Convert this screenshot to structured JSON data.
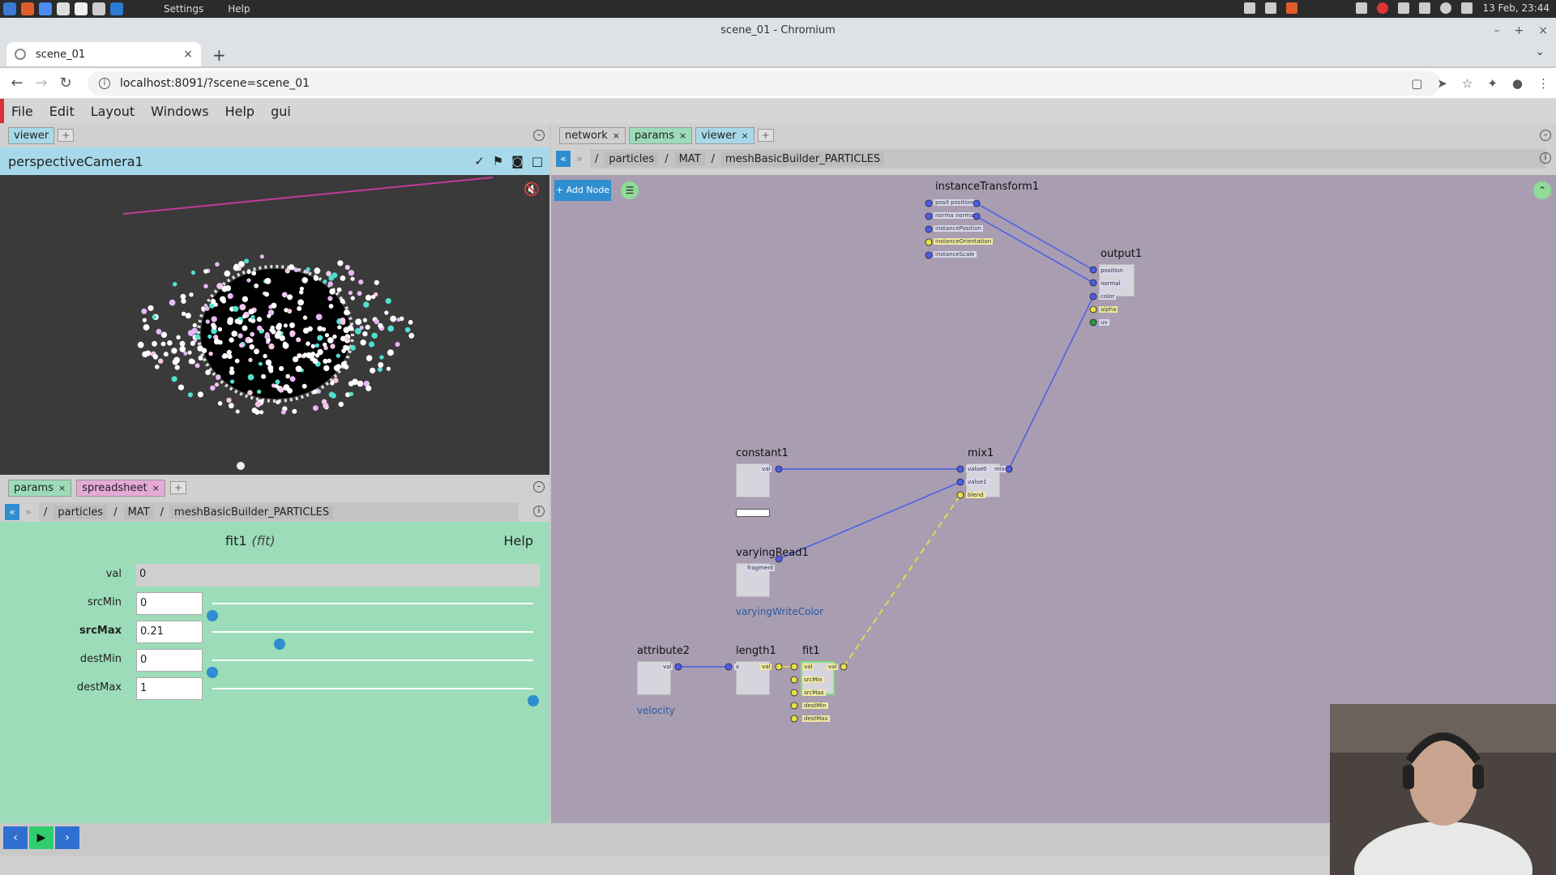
{
  "os": {
    "menu": [
      "Settings",
      "Help"
    ],
    "datetime": "13 Feb, 23:44"
  },
  "browser": {
    "window_title": "scene_01 - Chromium",
    "tab_title": "scene_01",
    "url": "localhost:8091/?scene=scene_01"
  },
  "app": {
    "menu": [
      "File",
      "Edit",
      "Layout",
      "Windows",
      "Help",
      "gui"
    ],
    "viewer_tab": "viewer",
    "camera_name": "perspectiveCamera1",
    "params_tabs": [
      "params",
      "spreadsheet"
    ],
    "network_tabs": [
      "network",
      "params",
      "viewer"
    ],
    "breadcrumb": [
      "particles",
      "MAT",
      "meshBasicBuilder_PARTICLES"
    ],
    "add_node_label": "+ Add Node"
  },
  "params": {
    "node_name": "fit1",
    "node_type": "(fit)",
    "help": "Help",
    "rows": [
      {
        "label": "val",
        "value": "0"
      },
      {
        "label": "srcMin",
        "value": "0",
        "fraction": 0.0
      },
      {
        "label": "srcMax",
        "value": "0.21",
        "fraction": 0.21
      },
      {
        "label": "destMin",
        "value": "0",
        "fraction": 0.0
      },
      {
        "label": "destMax",
        "value": "1",
        "fraction": 1.0
      }
    ]
  },
  "network": {
    "nodes": {
      "instanceTransform1": "instanceTransform1",
      "output1": "output1",
      "constant1": "constant1",
      "mix1": "mix1",
      "varyingRead1": "varyingRead1",
      "attribute2": "attribute2",
      "length1": "length1",
      "fit1": "fit1"
    },
    "instance_ports": [
      "positi",
      "position",
      "normal",
      "normal",
      "instancePosition",
      "instanceOrientation",
      "instanceScale"
    ],
    "output_ports": [
      "position",
      "normal",
      "color",
      "alpha",
      "uv"
    ],
    "constant_port": "val",
    "mix_ports": [
      "value0",
      "mix",
      "value1",
      "blend"
    ],
    "varying_port": "fragment",
    "varying_label": "varyingWriteColor",
    "attribute_port": "val",
    "attribute_label": "velocity",
    "length_ports": [
      "x",
      "val"
    ],
    "fit_ports": [
      "val",
      "val",
      "srcMin",
      "srcMax",
      "destMin",
      "destMax"
    ]
  },
  "colors": {
    "viewer_tab": "#a7d9ea",
    "params_bg": "#9cdcb9",
    "network_bg": "#a89db1",
    "accent": "#2f8ecf"
  }
}
